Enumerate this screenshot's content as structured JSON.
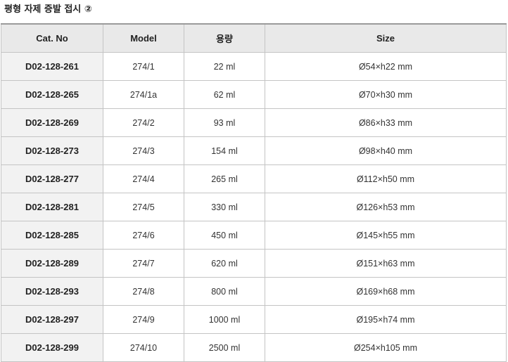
{
  "page": {
    "title": "평형 자제 증발 접시 ②"
  },
  "table": {
    "headers": [
      "Cat. No",
      "Model",
      "용량",
      "Size"
    ],
    "rows": [
      [
        "D02-128-261",
        "274/1",
        "22 ml",
        "Ø54×h22 mm"
      ],
      [
        "D02-128-265",
        "274/1a",
        "62 ml",
        "Ø70×h30 mm"
      ],
      [
        "D02-128-269",
        "274/2",
        "93 ml",
        "Ø86×h33 mm"
      ],
      [
        "D02-128-273",
        "274/3",
        "154 ml",
        "Ø98×h40 mm"
      ],
      [
        "D02-128-277",
        "274/4",
        "265 ml",
        "Ø112×h50 mm"
      ],
      [
        "D02-128-281",
        "274/5",
        "330 ml",
        "Ø126×h53 mm"
      ],
      [
        "D02-128-285",
        "274/6",
        "450 ml",
        "Ø145×h55 mm"
      ],
      [
        "D02-128-289",
        "274/7",
        "620 ml",
        "Ø151×h63 mm"
      ],
      [
        "D02-128-293",
        "274/8",
        "800 ml",
        "Ø169×h68 mm"
      ],
      [
        "D02-128-297",
        "274/9",
        "1000 ml",
        "Ø195×h74 mm"
      ],
      [
        "D02-128-299",
        "274/10",
        "2500 ml",
        "Ø254×h105 mm"
      ]
    ]
  },
  "colors": {
    "header_bg": "#e9e9e9",
    "cat_column_bg": "#f2f2f2",
    "border": "#c4c4c4"
  }
}
